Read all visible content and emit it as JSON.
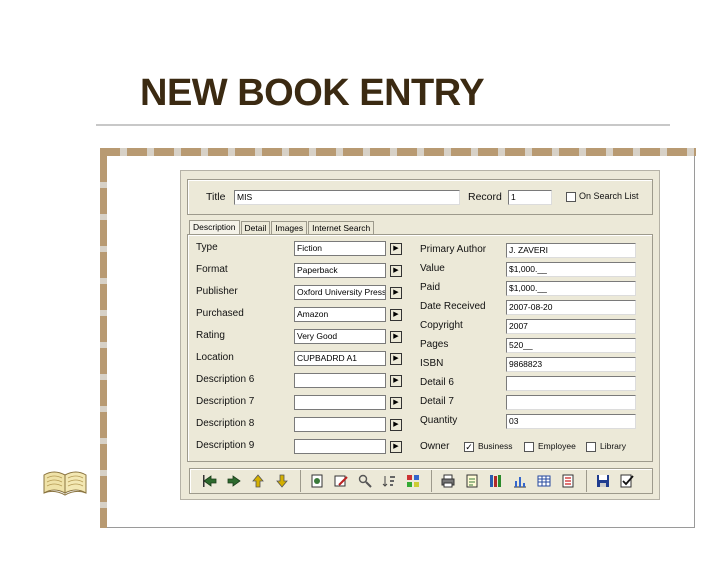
{
  "slide": {
    "title": "NEW BOOK ENTRY"
  },
  "header": {
    "title_label": "Title",
    "title_value": "MIS",
    "record_label": "Record",
    "record_value": "1",
    "on_search_list_label": "On Search List",
    "on_search_list_checked": false
  },
  "tabs": [
    {
      "label": "Description",
      "active": true
    },
    {
      "label": "Detail",
      "active": false
    },
    {
      "label": "Images",
      "active": false
    },
    {
      "label": "Internet Search",
      "active": false
    }
  ],
  "left_fields": [
    {
      "label": "Type",
      "value": "Fiction"
    },
    {
      "label": "Format",
      "value": "Paperback"
    },
    {
      "label": "Publisher",
      "value": "Oxford University Press"
    },
    {
      "label": "Purchased",
      "value": "Amazon"
    },
    {
      "label": "Rating",
      "value": "Very Good"
    },
    {
      "label": "Location",
      "value": "CUPBADRD A1"
    },
    {
      "label": "Description 6",
      "value": ""
    },
    {
      "label": "Description 7",
      "value": ""
    },
    {
      "label": "Description 8",
      "value": ""
    },
    {
      "label": "Description 9",
      "value": ""
    }
  ],
  "right_fields": [
    {
      "label": "Primary Author",
      "value": "J. ZAVERI"
    },
    {
      "label": "Value",
      "value": "$1,000.__"
    },
    {
      "label": "Paid",
      "value": "$1,000.__"
    },
    {
      "label": "Date Received",
      "value": "2007-08-20"
    },
    {
      "label": "Copyright",
      "value": "2007"
    },
    {
      "label": "Pages",
      "value": "520__"
    },
    {
      "label": "ISBN",
      "value": "9868823"
    },
    {
      "label": "Detail 6",
      "value": ""
    },
    {
      "label": "Detail 7",
      "value": ""
    },
    {
      "label": "Quantity",
      "value": "03"
    }
  ],
  "owner": {
    "label": "Owner",
    "options": [
      {
        "label": "Business",
        "checked": true
      },
      {
        "label": "Employee",
        "checked": false
      },
      {
        "label": "Library",
        "checked": false
      }
    ]
  },
  "toolbar": {
    "icons": [
      "first-record-icon",
      "previous-record-icon",
      "next-record-icon",
      "last-record-icon",
      "new-record-icon",
      "edit-record-icon",
      "find-icon",
      "sort-icon",
      "filter-icon",
      "print-icon",
      "report-icon",
      "books-icon",
      "chart-icon",
      "table-icon",
      "list-icon",
      "save-icon",
      "done-icon"
    ]
  },
  "colors": {
    "title": "#3b2a12",
    "window_bg": "#ece9d8",
    "dash_brown": "#b89a72"
  }
}
